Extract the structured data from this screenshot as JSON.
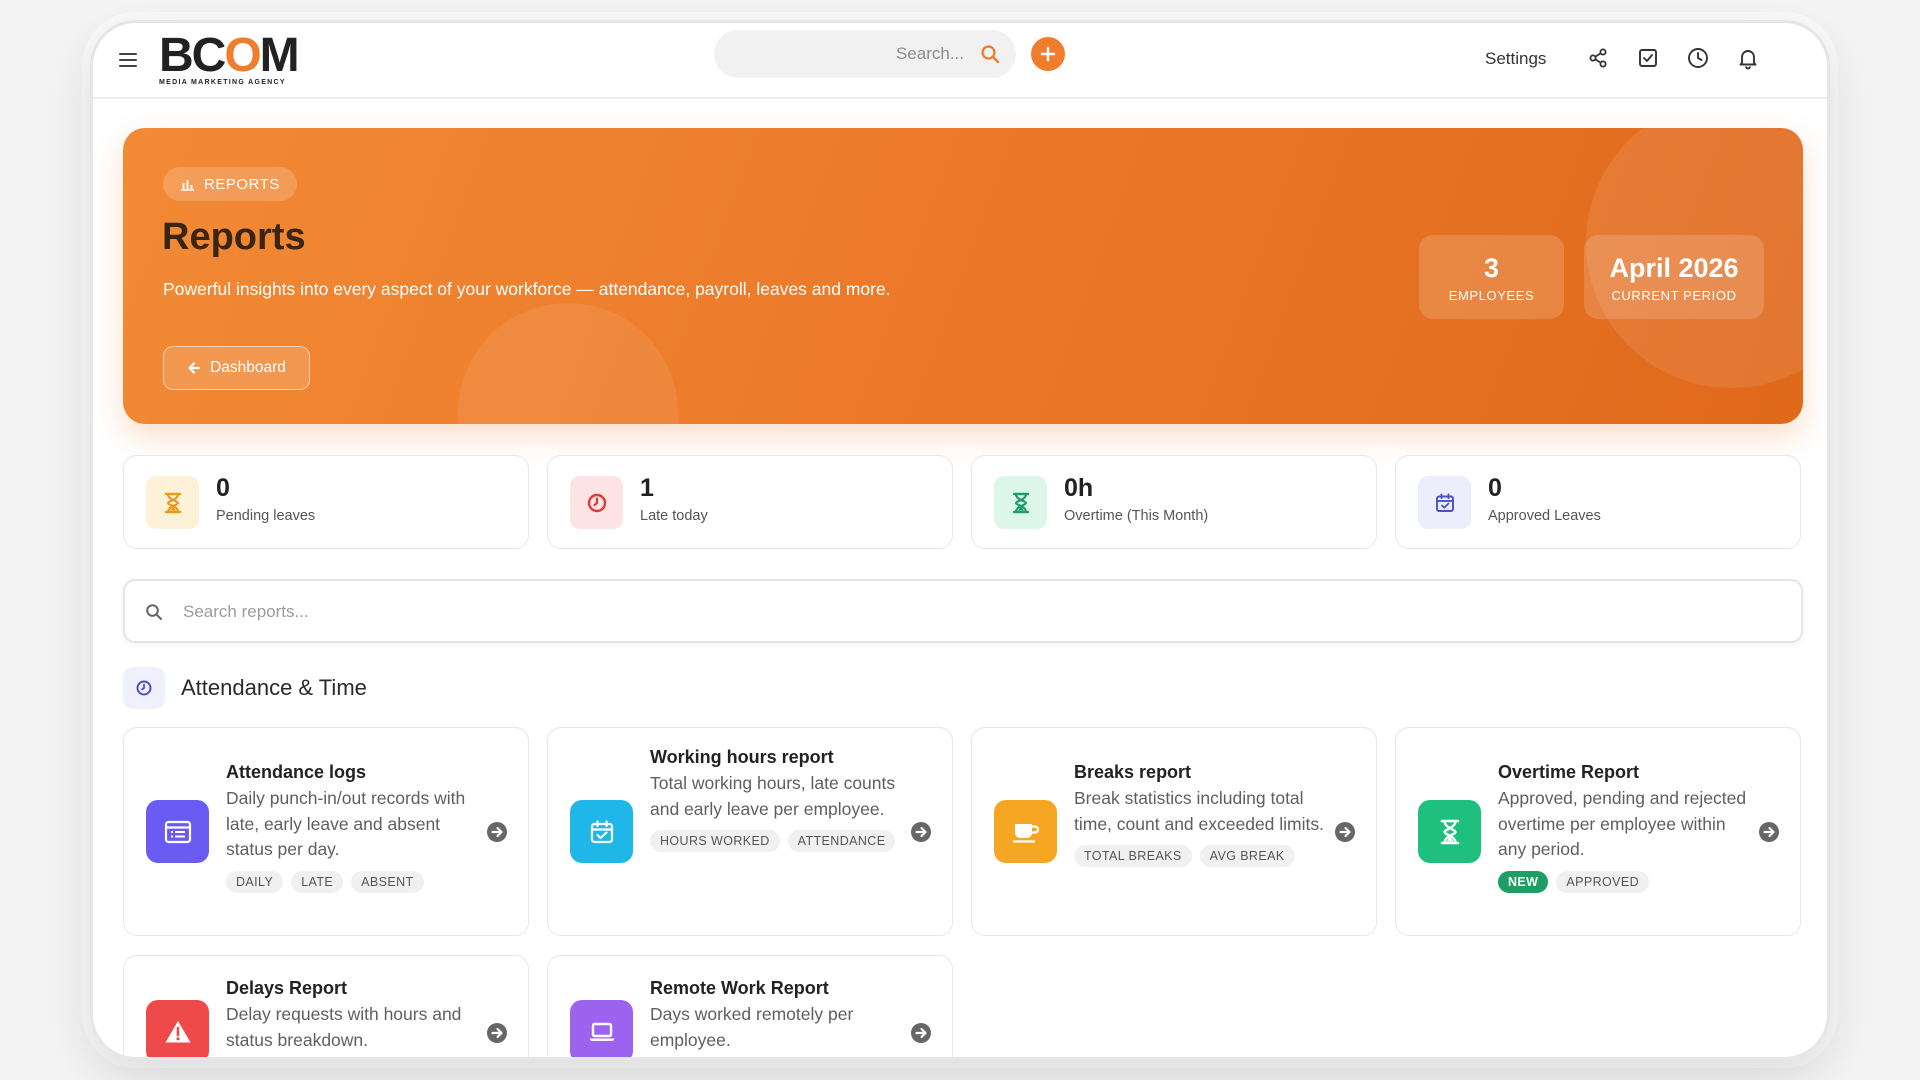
{
  "header": {
    "logo_text": "BCOM",
    "logo_tagline": "MEDIA MARKETING AGENCY",
    "search_placeholder": "Search...",
    "settings_label": "Settings"
  },
  "hero": {
    "badge": "REPORTS",
    "title": "Reports",
    "subtitle": "Powerful insights into every aspect of your workforce — attendance, payroll, leaves and more.",
    "back_button": "Dashboard",
    "stats": [
      {
        "value": "3",
        "label": "EMPLOYEES"
      },
      {
        "value": "April 2026",
        "label": "CURRENT PERIOD"
      }
    ]
  },
  "kpis": [
    {
      "value": "0",
      "label": "Pending leaves",
      "icon": "hourglass-icon",
      "color": "#f0a83a",
      "bg": "#fdf1d8"
    },
    {
      "value": "1",
      "label": "Late today",
      "icon": "clock-icon",
      "color": "#e03a3a",
      "bg": "#fde3e3"
    },
    {
      "value": "0h",
      "label": "Overtime (This Month)",
      "icon": "hourglass-icon",
      "color": "#1f9d6a",
      "bg": "#dcf6ea"
    },
    {
      "value": "0",
      "label": "Approved Leaves",
      "icon": "calendar-check-icon",
      "color": "#4b4ecf",
      "bg": "#eceefb"
    }
  ],
  "report_search": {
    "placeholder": "Search reports..."
  },
  "section": {
    "title": "Attendance & Time"
  },
  "cards": [
    {
      "title": "Attendance logs",
      "description": "Daily punch-in/out records with late, early leave and absent status per day.",
      "tags": [
        "DAILY",
        "LATE",
        "ABSENT"
      ],
      "icon": "list-icon",
      "color": "#6a5cf2"
    },
    {
      "title": "Working hours report",
      "description": "Total working hours, late counts and early leave per employee.",
      "tags": [
        "HOURS WORKED",
        "ATTENDANCE"
      ],
      "icon": "calendar-check-icon",
      "color": "#1fb6e8"
    },
    {
      "title": "Breaks report",
      "description": "Break statistics including total time, count and exceeded limits.",
      "tags": [
        "TOTAL BREAKS",
        "AVG BREAK"
      ],
      "icon": "coffee-icon",
      "color": "#f5a623"
    },
    {
      "title": "Overtime Report",
      "description": "Approved, pending and rejected overtime per employee within any period.",
      "tags": [
        "NEW",
        "APPROVED"
      ],
      "icon": "hourglass-icon",
      "color": "#1fbf7e"
    },
    {
      "title": "Delays Report",
      "description": "Delay requests with hours and status breakdown.",
      "tags": [],
      "icon": "warning-icon",
      "color": "#ee4a4a"
    },
    {
      "title": "Remote Work Report",
      "description": "Days worked remotely per employee.",
      "tags": [],
      "icon": "laptop-icon",
      "color": "#9c63ef"
    }
  ]
}
